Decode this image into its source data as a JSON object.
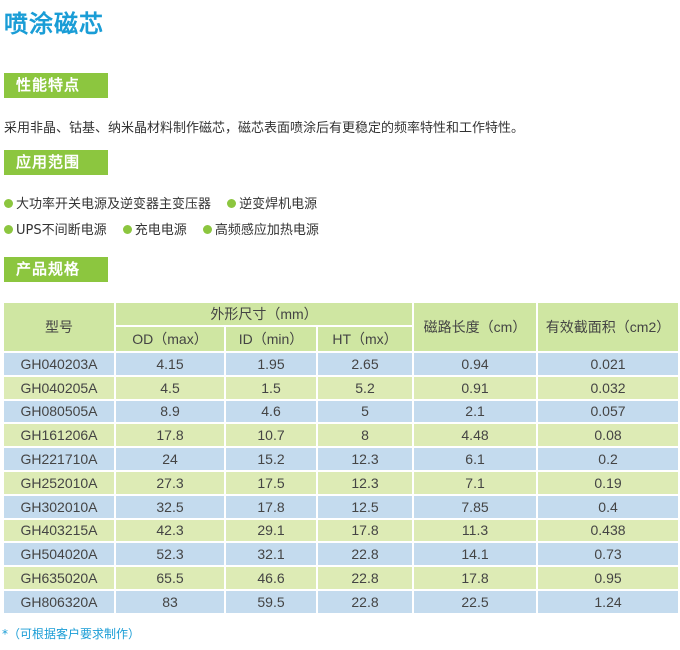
{
  "title": "喷涂磁芯",
  "sections": {
    "features": {
      "label": "性能特点",
      "text": "采用非晶、钴基、纳米晶材料制作磁芯，磁芯表面喷涂后有更稳定的频率特性和工作特性。"
    },
    "applications": {
      "label": "应用范围",
      "items": [
        "大功率开关电源及逆变器主变压器",
        "逆变焊机电源",
        "UPS不间断电源",
        "充电电源",
        "高频感应加热电源"
      ]
    },
    "specs": {
      "label": "产品规格"
    }
  },
  "table": {
    "headers": {
      "model": "型号",
      "dimensions": "外形尺寸（mm）",
      "od": "OD（max）",
      "id": "ID（min）",
      "ht": "HT（mx）",
      "path_length": "磁路长度（cm）",
      "cross_section": "有效截面积（cm2）"
    },
    "rows": [
      [
        "GH040203A",
        "4.15",
        "1.95",
        "2.65",
        "0.94",
        "0.021"
      ],
      [
        "GH040205A",
        "4.5",
        "1.5",
        "5.2",
        "0.91",
        "0.032"
      ],
      [
        "GH080505A",
        "8.9",
        "4.6",
        "5",
        "2.1",
        "0.057"
      ],
      [
        "GH161206A",
        "17.8",
        "10.7",
        "8",
        "4.48",
        "0.08"
      ],
      [
        "GH221710A",
        "24",
        "15.2",
        "12.3",
        "6.1",
        "0.2"
      ],
      [
        "GH252010A",
        "27.3",
        "17.5",
        "12.3",
        "7.1",
        "0.19"
      ],
      [
        "GH302010A",
        "32.5",
        "17.8",
        "12.5",
        "7.85",
        "0.4"
      ],
      [
        "GH403215A",
        "42.3",
        "29.1",
        "17.8",
        "11.3",
        "0.438"
      ],
      [
        "GH504020A",
        "52.3",
        "32.1",
        "22.8",
        "14.1",
        "0.73"
      ],
      [
        "GH635020A",
        "65.5",
        "46.6",
        "22.8",
        "17.8",
        "0.95"
      ],
      [
        "GH806320A",
        "83",
        "59.5",
        "22.8",
        "22.5",
        "1.24"
      ]
    ]
  },
  "footnote": "*（可根据客户要求制作）",
  "colors": {
    "title": "#1a9dd6",
    "tag": "#8cc63f",
    "header_bg": "#cfe6a2",
    "row_blue": "#c4dbee",
    "row_green": "#ddebb5"
  }
}
